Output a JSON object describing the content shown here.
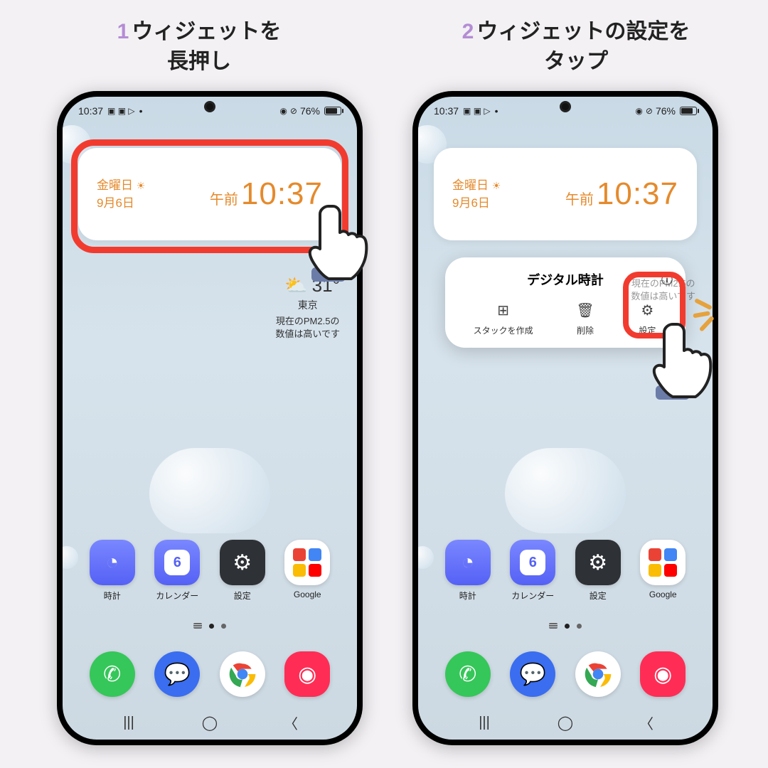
{
  "steps": {
    "s1": {
      "num": "1",
      "text": "ウィジェットを\n長押し"
    },
    "s2": {
      "num": "2",
      "text": "ウィジェットの設定を\nタップ"
    }
  },
  "status": {
    "time": "10:37",
    "battery": "76%"
  },
  "clock_widget": {
    "day": "金曜日",
    "date": "9月6日",
    "ampm": "午前",
    "time": "10:37"
  },
  "weather": {
    "temp": "31°",
    "location": "東京",
    "pm_line1": "現在のPM2.5の",
    "pm_line2": "数値は高いです"
  },
  "apps": {
    "clock": "時計",
    "calendar": "カレンダー",
    "cal_num": "6",
    "settings": "設定",
    "google": "Google"
  },
  "popup": {
    "title": "デジタル時計",
    "stack": "スタックを作成",
    "delete": "削除",
    "settings": "設定"
  }
}
